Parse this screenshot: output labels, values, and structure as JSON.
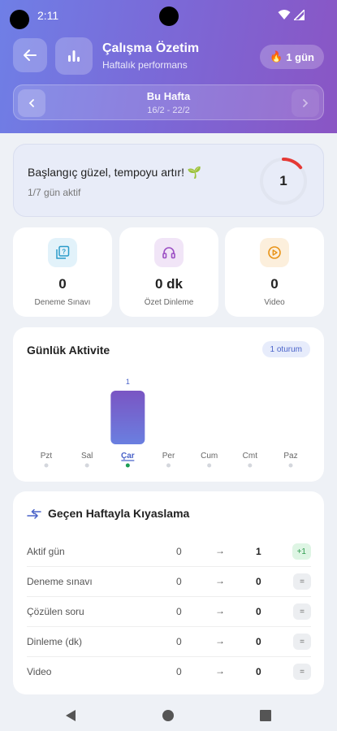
{
  "status": {
    "time": "2:11"
  },
  "header": {
    "title": "Çalışma Özetim",
    "subtitle": "Haftalık performans",
    "streak_emoji": "🔥",
    "streak_label": "1 gün"
  },
  "week": {
    "title": "Bu Hafta",
    "range": "16/2 - 22/2"
  },
  "banner": {
    "message": "Başlangıç güzel, tempoyu artır! 🌱",
    "sub": "1/7 gün aktif",
    "ring_value": "1",
    "ring_fraction": 0.142857,
    "ring_color": "#e53935"
  },
  "stats": [
    {
      "value": "0",
      "label": "Deneme Sınavı",
      "icon": "quiz-icon",
      "color": "#2a9bc9"
    },
    {
      "value": "0 dk",
      "label": "Özet Dinleme",
      "icon": "headphones-icon",
      "color": "#9c4fc4"
    },
    {
      "value": "0",
      "label": "Video",
      "icon": "play-circle-icon",
      "color": "#e89317"
    }
  ],
  "activity": {
    "title": "Günlük Aktivite",
    "sessions_label": "1 oturum"
  },
  "chart_data": {
    "type": "bar",
    "categories": [
      "Pzt",
      "Sal",
      "Çar",
      "Per",
      "Cum",
      "Cmt",
      "Paz"
    ],
    "values": [
      0,
      0,
      1,
      0,
      0,
      0,
      0
    ],
    "active": [
      false,
      false,
      true,
      false,
      false,
      false,
      false
    ],
    "title": "Günlük Aktivite",
    "highlight_index": 2,
    "bar_color_top": "#7a55c3",
    "bar_color_bottom": "#6a7fe0",
    "active_dot_color": "#1e9e55"
  },
  "compare": {
    "title": "Geçen Haftayla Kıyaslama",
    "arrow": "→",
    "rows": [
      {
        "label": "Aktif gün",
        "prev": "0",
        "cur": "1",
        "badge": "+1",
        "type": "up"
      },
      {
        "label": "Deneme sınavı",
        "prev": "0",
        "cur": "0",
        "badge": "=",
        "type": "eq"
      },
      {
        "label": "Çözülen soru",
        "prev": "0",
        "cur": "0",
        "badge": "=",
        "type": "eq"
      },
      {
        "label": "Dinleme (dk)",
        "prev": "0",
        "cur": "0",
        "badge": "=",
        "type": "eq"
      },
      {
        "label": "Video",
        "prev": "0",
        "cur": "0",
        "badge": "=",
        "type": "eq"
      }
    ]
  }
}
